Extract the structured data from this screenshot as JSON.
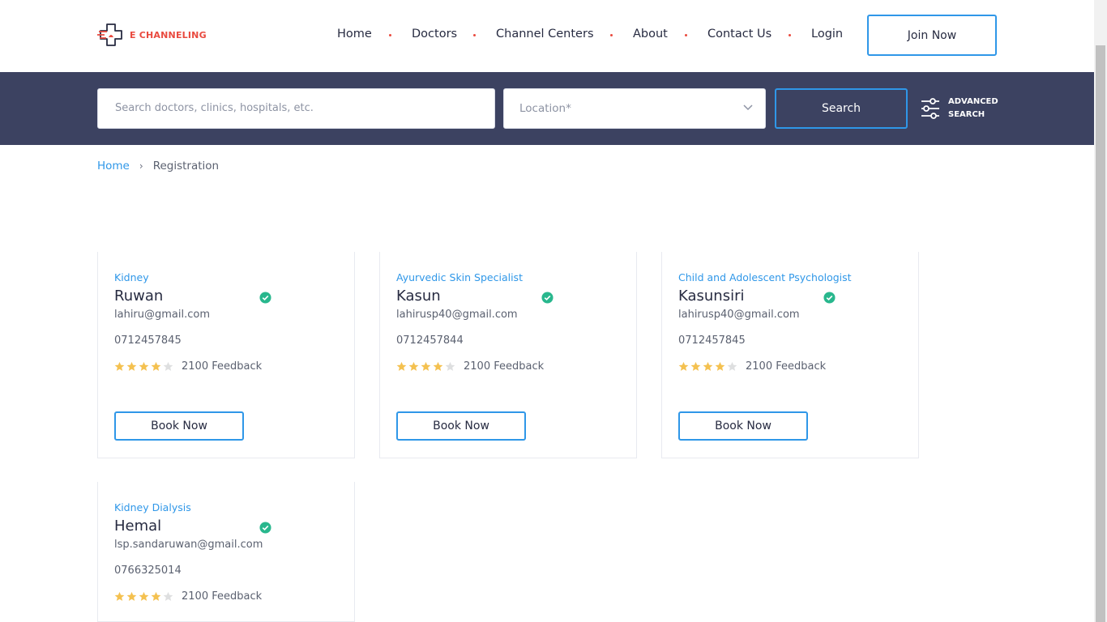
{
  "brand": {
    "name": "E CHANNELING",
    "accent": "#e94a3f",
    "primary": "#2f97e8",
    "dark": "#3c4261"
  },
  "nav": {
    "items": [
      "Home",
      "Doctors",
      "Channel Centers",
      "About",
      "Contact Us",
      "Login"
    ],
    "join_label": "Join Now"
  },
  "search": {
    "placeholder": "Search doctors, clinics, hospitals, etc.",
    "location_placeholder": "Location*",
    "button_label": "Search",
    "advanced_line1": "ADVANCED",
    "advanced_line2": "SEARCH"
  },
  "breadcrumb": {
    "home": "Home",
    "current": "Registration"
  },
  "doctors": [
    {
      "specialty": "Kidney",
      "name": "Ruwan",
      "email": "lahiru@gmail.com",
      "phone": "0712457845",
      "rating": 4,
      "feedback": "2100 Feedback",
      "book_label": "Book Now"
    },
    {
      "specialty": "Ayurvedic Skin Specialist",
      "name": "Kasun",
      "email": "lahirusp40@gmail.com",
      "phone": "0712457844",
      "rating": 4,
      "feedback": "2100 Feedback",
      "book_label": "Book Now"
    },
    {
      "specialty": "Child and Adolescent Psychologist",
      "name": "Kasunsiri",
      "email": "lahirusp40@gmail.com",
      "phone": "0712457845",
      "rating": 4,
      "feedback": "2100 Feedback",
      "book_label": "Book Now"
    },
    {
      "specialty": "Kidney Dialysis",
      "name": "Hemal",
      "email": "lsp.sandaruwan@gmail.com",
      "phone": "0766325014",
      "rating": 4,
      "feedback": "2100 Feedback",
      "book_label": "Book Now"
    }
  ],
  "colors": {
    "star_on": "#f4c150",
    "star_off": "#dedfe0",
    "verified": "#28b78d"
  }
}
